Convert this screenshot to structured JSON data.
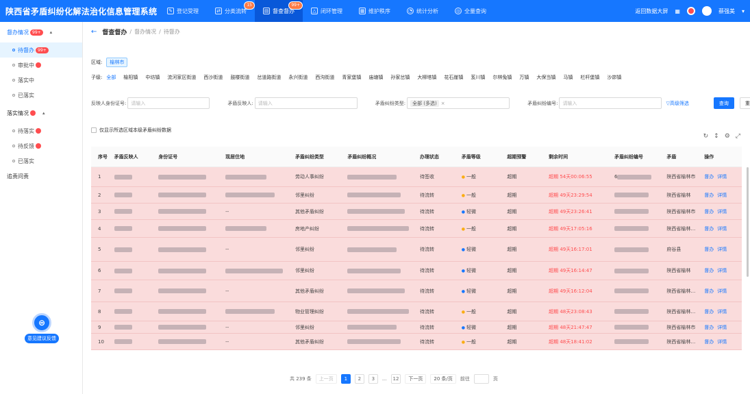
{
  "app": {
    "title": "陕西省矛盾纠纷化解法治化信息管理系统",
    "nav": [
      {
        "label": "登记受理",
        "icon": "register-icon"
      },
      {
        "label": "分类流转",
        "icon": "transfer-icon",
        "badge": "15"
      },
      {
        "label": "督查督办",
        "icon": "supervise-icon",
        "badge": "99+",
        "active": true
      },
      {
        "label": "闭环管理",
        "icon": "loop-icon"
      },
      {
        "label": "维护秩序",
        "icon": "order-icon"
      },
      {
        "label": "统计分析",
        "icon": "stats-icon"
      },
      {
        "label": "全量查询",
        "icon": "query-icon"
      }
    ],
    "right": {
      "bigscreen": "返回数据大屏",
      "user": "蔡强美"
    }
  },
  "sidebar": {
    "group1": {
      "label": "督办情况",
      "badge": "99+"
    },
    "group1_items": [
      {
        "label": "待督办",
        "badge": "99+",
        "active": true
      },
      {
        "label": "审批中",
        "dot": true
      },
      {
        "label": "落实中"
      },
      {
        "label": "已落实"
      }
    ],
    "group2": {
      "label": "落实情况"
    },
    "group2_items": [
      {
        "label": "待落实",
        "dot": true
      },
      {
        "label": "待反馈",
        "dot": true
      },
      {
        "label": "已落实"
      }
    ],
    "group3": {
      "label": "追责问责"
    },
    "feedback": "意见建议反馈"
  },
  "breadcrumb": {
    "current": "督查督办",
    "p1": "督办情况",
    "p2": "待督办"
  },
  "filters": {
    "region_label": "区域:",
    "region_value": "榆林市",
    "sub_label": "子级:",
    "towns": [
      "全部",
      "榆阳镇",
      "中坊镇",
      "流河家区街道",
      "西沙街道",
      "鼓楼街道",
      "岔道路街道",
      "永兴街道",
      "西沟街道",
      "青家堡镇",
      "庙塘镇",
      "孙家岔镇",
      "大柳塔镇",
      "花石崖镇",
      "芨川镇",
      "尔林兔镇",
      "万镇",
      "大保当镇",
      "马镇",
      "栏杆堡镇",
      "沙峁镇"
    ],
    "id_label": "反映人身份证号:",
    "id_ph": "请输入",
    "reporter_label": "矛盾反映人:",
    "reporter_ph": "请输入",
    "type_label": "矛盾纠纷类型:",
    "type_value": "全部 (多选)",
    "code_label": "矛盾纠纷编号:",
    "code_ph": "请输入",
    "advanced": "高级筛选",
    "search": "查询",
    "reset": "重置",
    "only_region": "仅显示所选区域本级矛盾纠纷数据"
  },
  "table": {
    "headers": {
      "idx": "序号",
      "name": "矛盾反映人",
      "id": "身份证号",
      "addr": "现居住地",
      "type": "矛盾纠纷类型",
      "desc": "矛盾纠纷概况",
      "state": "办理状态",
      "level": "矛盾等级",
      "warn": "超期预警",
      "remain": "剩余时间",
      "code": "矛盾纠纷编号",
      "region": "矛盾",
      "op": "操作"
    },
    "rows": [
      {
        "idx": "1",
        "addr": "",
        "type": "劳动人事纠纷",
        "state": "待签收",
        "level": "一般",
        "lvl": "normal",
        "warn": "超期",
        "remain": "超期 54天00:06:55",
        "code": "6",
        "region": "陕西省榆林市"
      },
      {
        "idx": "2",
        "addr": "",
        "type": "邻里纠纷",
        "state": "待流转",
        "level": "一般",
        "lvl": "normal",
        "warn": "超期",
        "remain": "超期 49天23:29:54",
        "code": "",
        "region": "陕西省榆林"
      },
      {
        "idx": "3",
        "addr": "--",
        "type": "其他矛盾纠纷",
        "state": "待流转",
        "level": "轻微",
        "lvl": "light",
        "warn": "超期",
        "remain": "超期 49天23:26:41",
        "code": "",
        "region": "陕西省榆林市"
      },
      {
        "idx": "4",
        "addr": "",
        "type": "房地产纠纷",
        "state": "待流转",
        "level": "一般",
        "lvl": "normal",
        "warn": "超期",
        "remain": "超期 49天17:05:16",
        "code": "",
        "region": "陕西省榆林市神"
      },
      {
        "idx": "5",
        "addr": "--",
        "type": "邻里纠纷",
        "state": "待流转",
        "level": "轻微",
        "lvl": "light",
        "warn": "超期",
        "remain": "超期 49天16:17:01",
        "code": "",
        "region": "府谷县"
      },
      {
        "idx": "6",
        "addr": "",
        "type": "邻里纠纷",
        "state": "待流转",
        "level": "轻微",
        "lvl": "light",
        "warn": "超期",
        "remain": "超期 49天16:14:47",
        "code": "",
        "region": "陕西省榆林"
      },
      {
        "idx": "7",
        "addr": "--",
        "type": "其他矛盾纠纷",
        "state": "待流转",
        "level": "轻微",
        "lvl": "light",
        "warn": "超期",
        "remain": "超期 49天16:12:04",
        "code": "",
        "region": "陕西省榆林市神"
      },
      {
        "idx": "8",
        "addr": "",
        "type": "物业管理纠纷",
        "state": "待流转",
        "level": "一般",
        "lvl": "normal",
        "warn": "超期",
        "remain": "超期 48天23:08:43",
        "code": "",
        "region": "陕西省榆林市神"
      },
      {
        "idx": "9",
        "addr": "--",
        "type": "邻里纠纷",
        "state": "待流转",
        "level": "轻微",
        "lvl": "light",
        "warn": "超期",
        "remain": "超期 48天21:47:47",
        "code": "",
        "region": "陕西省榆林市"
      },
      {
        "idx": "10",
        "addr": "--",
        "type": "其他矛盾纠纷",
        "state": "待流转",
        "level": "一般",
        "lvl": "normal",
        "warn": "超期",
        "remain": "超期 48天18:41:02",
        "code": "",
        "region": "陕西省榆林市神"
      }
    ],
    "op_supervise": "督办",
    "op_detail": "详情"
  },
  "pager": {
    "total": "共 239 条",
    "prev": "上一页",
    "pages": [
      "1",
      "2",
      "3",
      "...",
      "12"
    ],
    "next": "下一页",
    "size": "20 条/页",
    "goto": "前往",
    "page_unit": "页"
  }
}
